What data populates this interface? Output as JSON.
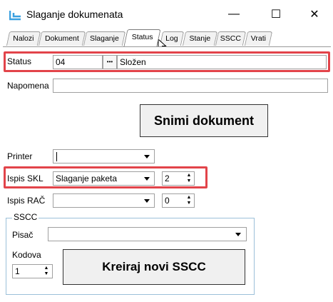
{
  "window": {
    "title": "Slaganje dokumenata",
    "controls": {
      "minimize": "—",
      "maximize": "☐",
      "close": "✕"
    }
  },
  "tabs": [
    {
      "label": "Nalozi"
    },
    {
      "label": "Dokument"
    },
    {
      "label": "Slaganje"
    },
    {
      "label": "Status",
      "active": true
    },
    {
      "label": "Log"
    },
    {
      "label": "Stanje"
    },
    {
      "label": "SSCC"
    },
    {
      "label": "Vrati"
    }
  ],
  "status": {
    "label": "Status",
    "code": "04",
    "ellipsis": "•••",
    "value": "Složen"
  },
  "napomena": {
    "label": "Napomena",
    "value": ""
  },
  "save_button": "Snimi dokument",
  "printer": {
    "label": "Printer",
    "value": ""
  },
  "ispis_skl": {
    "label": "Ispis SKL",
    "value": "Slaganje paketa",
    "count": "2"
  },
  "ispis_rac": {
    "label": "Ispis RAČ",
    "value": "",
    "count": "0"
  },
  "sscc": {
    "group_title": "SSCC",
    "pisac_label": "Pisač",
    "pisac_value": "",
    "kodova_label": "Kodova",
    "kodova_value": "1",
    "create_button": "Kreiraj novi SSCC"
  },
  "colors": {
    "highlight": "#e2444a",
    "group_border": "#9cc0d9",
    "icon": "#3aa0e0"
  },
  "icons": [
    "app-icon",
    "ellipsis-icon",
    "dropdown-arrow-icon",
    "spin-up-icon",
    "spin-down-icon",
    "mouse-cursor-icon"
  ]
}
